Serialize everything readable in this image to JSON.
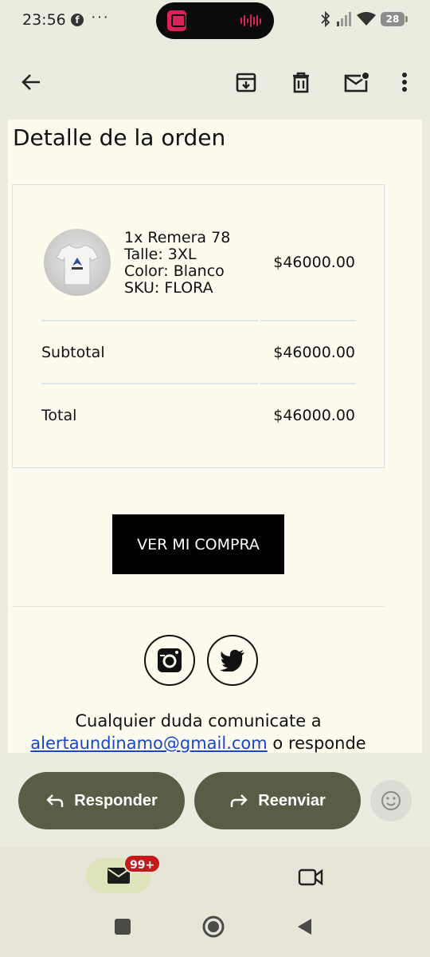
{
  "status_bar": {
    "time": "23:56",
    "facebook_glyph": "f",
    "more": "···",
    "battery": "28",
    "icons": [
      "bluetooth-icon",
      "signal-icon",
      "wifi-icon",
      "battery-icon"
    ]
  },
  "app_bar": {
    "icons": [
      "back-arrow-icon",
      "archive-icon",
      "delete-icon",
      "mark-unread-icon",
      "more-vert-icon"
    ]
  },
  "email": {
    "title": "Detalle de la orden",
    "item": {
      "line1": "1x Remera 78",
      "line2": "Talle: 3XL",
      "line3": "Color: Blanco",
      "line4": "SKU: FLORA",
      "price": "$46000.00"
    },
    "subtotal_label": "Subtotal",
    "subtotal_value": "$46000.00",
    "total_label": "Total",
    "total_value": "$46000.00",
    "cta_label": "VER MI COMPRA",
    "social_icons": [
      "instagram-icon",
      "twitter-icon"
    ],
    "footer_text": "Cualquier duda comunicate a",
    "footer_email": "alertaundinamo@gmail.com",
    "footer_suffix": " o responde"
  },
  "actions": {
    "reply": "Responder",
    "forward": "Reenviar"
  },
  "bottom_nav": {
    "mail_badge": "99+"
  },
  "colors": {
    "background": "#ecebdf",
    "email_background": "#fcfbee",
    "pill": "#585d45",
    "badge": "#c6191c",
    "link": "#1a47c9"
  }
}
